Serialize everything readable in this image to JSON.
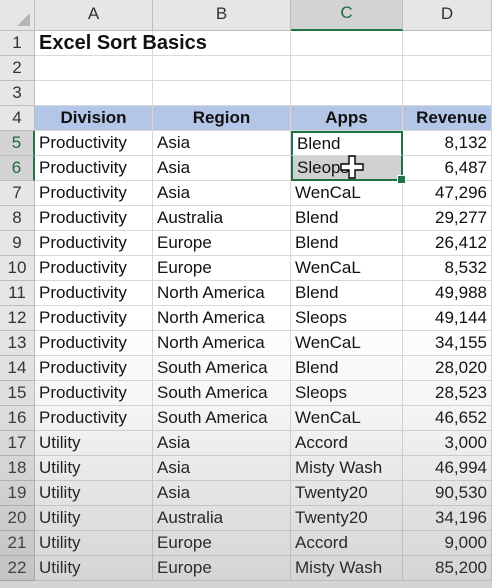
{
  "sheet": {
    "columns": [
      "A",
      "B",
      "C",
      "D"
    ],
    "selected_column": "C",
    "selected_rows": [
      5,
      6
    ],
    "title": "Excel Sort Basics",
    "header": {
      "division": "Division",
      "region": "Region",
      "apps": "Apps",
      "revenue": "Revenue"
    },
    "rows": [
      {
        "division": "Productivity",
        "region": "Asia",
        "apps": "Blend",
        "revenue": "8,132"
      },
      {
        "division": "Productivity",
        "region": "Asia",
        "apps": "Sleops",
        "revenue": "6,487"
      },
      {
        "division": "Productivity",
        "region": "Asia",
        "apps": "WenCaL",
        "revenue": "47,296"
      },
      {
        "division": "Productivity",
        "region": "Australia",
        "apps": "Blend",
        "revenue": "29,277"
      },
      {
        "division": "Productivity",
        "region": "Europe",
        "apps": "Blend",
        "revenue": "26,412"
      },
      {
        "division": "Productivity",
        "region": "Europe",
        "apps": "WenCaL",
        "revenue": "8,532"
      },
      {
        "division": "Productivity",
        "region": "North America",
        "apps": "Blend",
        "revenue": "49,988"
      },
      {
        "division": "Productivity",
        "region": "North America",
        "apps": "Sleops",
        "revenue": "49,144"
      },
      {
        "division": "Productivity",
        "region": "North America",
        "apps": "WenCaL",
        "revenue": "34,155"
      },
      {
        "division": "Productivity",
        "region": "South America",
        "apps": "Blend",
        "revenue": "28,020"
      },
      {
        "division": "Productivity",
        "region": "South America",
        "apps": "Sleops",
        "revenue": "28,523"
      },
      {
        "division": "Productivity",
        "region": "South America",
        "apps": "WenCaL",
        "revenue": "46,652"
      },
      {
        "division": "Utility",
        "region": "Asia",
        "apps": "Accord",
        "revenue": "3,000"
      },
      {
        "division": "Utility",
        "region": "Asia",
        "apps": "Misty Wash",
        "revenue": "46,994"
      },
      {
        "division": "Utility",
        "region": "Asia",
        "apps": "Twenty20",
        "revenue": "90,530"
      },
      {
        "division": "Utility",
        "region": "Australia",
        "apps": "Twenty20",
        "revenue": "34,196"
      },
      {
        "division": "Utility",
        "region": "Europe",
        "apps": "Accord",
        "revenue": "9,000"
      },
      {
        "division": "Utility",
        "region": "Europe",
        "apps": "Misty Wash",
        "revenue": "85,200"
      }
    ]
  },
  "icons": {
    "select_all": "select-all-triangle-icon",
    "cursor": "move-cursor-icon"
  },
  "colors": {
    "header_fill": "#b4c6e7",
    "selection": "#217346",
    "selected_cell_fill": "#d0d0d0"
  }
}
